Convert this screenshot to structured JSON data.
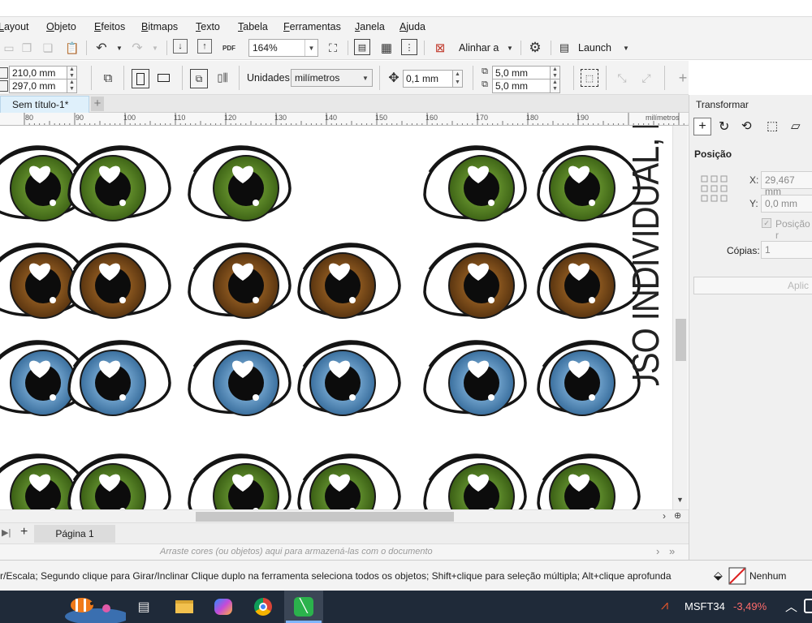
{
  "menu": [
    "Layout",
    "Objeto",
    "Efeitos",
    "Bitmaps",
    "Texto",
    "Tabela",
    "Ferramentas",
    "Janela",
    "Ajuda"
  ],
  "toolbar": {
    "zoom": "164%",
    "align_label": "Alinhar a",
    "launch_label": "Launch",
    "pdf_label": "PDF"
  },
  "property_bar": {
    "width": "210,0 mm",
    "height": "297,0 mm",
    "units_label": "Unidades:",
    "units_value": "milímetros",
    "nudge": "0,1 mm",
    "dup_x": "5,0 mm",
    "dup_y": "5,0 mm"
  },
  "doc_tab": "Sem título-1*",
  "ruler": {
    "ticks": [
      "80",
      "90",
      "100",
      "110",
      "120",
      "130",
      "140",
      "150",
      "160",
      "170",
      "180",
      "190"
    ],
    "unit": "milímetros"
  },
  "canvas": {
    "vertical_text": "USO INDIVIDUAL, N",
    "rows": [
      {
        "iris": "#6d9a32",
        "iris_dark": "#3e6416"
      },
      {
        "iris": "#9a6224",
        "iris_dark": "#5a3510"
      },
      {
        "iris": "#7fb0d8",
        "iris_dark": "#3a6f9e"
      },
      {
        "iris": "#6a9a34",
        "iris_dark": "#3a5e14"
      }
    ]
  },
  "page_tab": "Página 1",
  "palette_hint": "Arraste cores (ou objetos) aqui para armazená-las com o documento",
  "status_text": "r/Escala; Segundo clique para Girar/Inclinar Clique duplo na ferramenta seleciona todos os objetos; Shift+clique para seleção múltipla; Alt+clique aprofunda",
  "status_fill": "Nenhum",
  "panel": {
    "title": "Transformar",
    "section": "Posição",
    "x_label": "X:",
    "x_value": "29,467 mm",
    "y_label": "Y:",
    "y_value": "0,0 mm",
    "relative_label": "Posição r",
    "copies_label": "Cópias:",
    "copies_value": "1",
    "apply_label": "Aplic"
  },
  "taskbar": {
    "stock_symbol": "MSFT34",
    "stock_change": "-3,49%"
  }
}
